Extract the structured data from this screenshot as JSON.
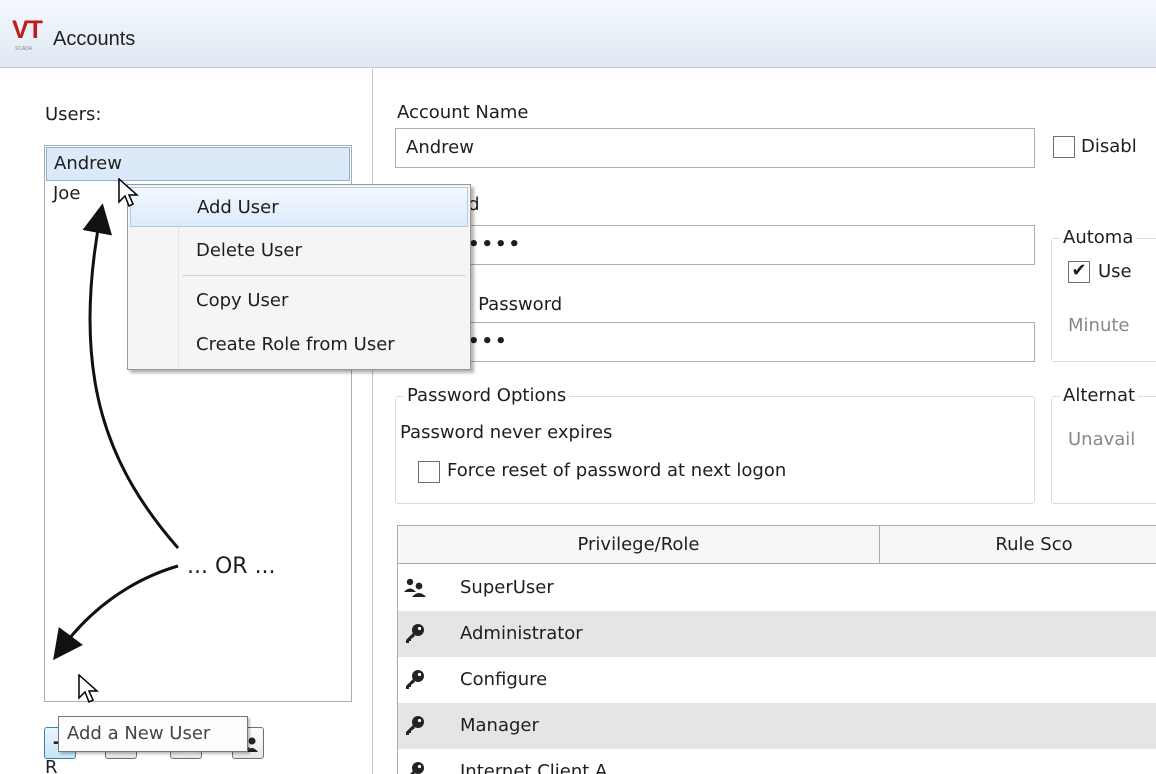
{
  "window": {
    "title": "Accounts",
    "logo_text": "VT",
    "logo_subtext": "SCADA"
  },
  "users": {
    "label": "Users:",
    "items": [
      "Andrew",
      "Joe"
    ],
    "selected": "Andrew"
  },
  "context_menu": {
    "items": [
      {
        "label": "Add User"
      },
      {
        "label": "Delete User"
      },
      {
        "label": "Copy User"
      },
      {
        "label": "Create Role from User"
      }
    ]
  },
  "annotation": {
    "or_text": "... OR ..."
  },
  "toolbar": {
    "add_label": "+",
    "delete_label": "−"
  },
  "tooltip": "Add a New User",
  "partial_label_below": "R",
  "form": {
    "account_name_label": "Account Name",
    "account_name_value": "Andrew",
    "disabled_label": "Disabl",
    "password_label_partial": "rd",
    "password_value": "••••",
    "confirm_label_partial": "n Password",
    "confirm_value": "•••",
    "auto_group_title": "Automa",
    "use_label": "Use",
    "minutes_label": "Minute",
    "password_options_title": "Password Options",
    "never_expires": "Password never expires",
    "force_reset_label": "Force reset of password at next logon",
    "alternate_title": "Alternat",
    "unavailable_text": "Unavail"
  },
  "grid": {
    "columns": [
      "Privilege/Role",
      "Rule Sco"
    ],
    "rows": [
      {
        "label": "SuperUser",
        "icon": "users-icon"
      },
      {
        "label": "Administrator",
        "icon": "key-icon"
      },
      {
        "label": "Configure",
        "icon": "key-icon"
      },
      {
        "label": "Manager",
        "icon": "key-icon"
      },
      {
        "label": "Internet Client A",
        "icon": "key-icon"
      }
    ]
  },
  "colors": {
    "logo_red": "#c01a1a",
    "selection_blue": "#dce9f8",
    "row_alt": "#e5e5e5"
  }
}
